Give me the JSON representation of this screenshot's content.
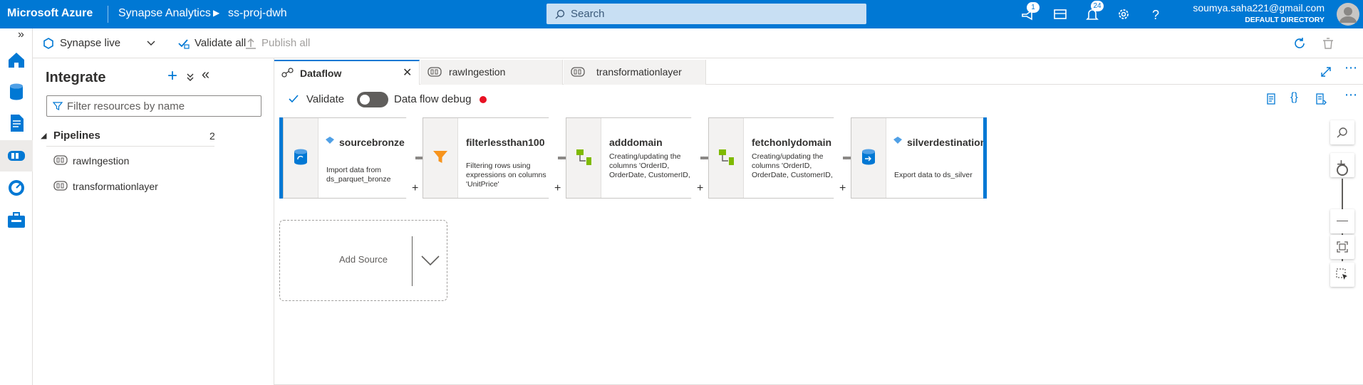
{
  "header": {
    "brand": "Microsoft Azure",
    "product": "Synapse Analytics",
    "workspace": "ss-proj-dwh",
    "search_placeholder": "Search",
    "feedback_badge": "1",
    "notifications_badge": "24",
    "user_email": "soumya.saha221@gmail.com",
    "user_directory": "DEFAULT DIRECTORY",
    "brand_color": "#0078d4"
  },
  "command_bar": {
    "mode_label": "Synapse live",
    "validate_all": "Validate all",
    "publish_all": "Publish all"
  },
  "rail": {
    "items": [
      "home-icon",
      "data-icon",
      "develop-icon",
      "integrate-icon",
      "monitor-icon",
      "manage-icon"
    ],
    "active": "integrate-icon"
  },
  "resource_panel": {
    "title": "Integrate",
    "filter_placeholder": "Filter resources by name",
    "group_label": "Pipelines",
    "group_count": "2",
    "items": [
      "rawIngestion",
      "transformationlayer"
    ]
  },
  "tabs": [
    {
      "label": "Dataflow",
      "active": true
    },
    {
      "label": "rawIngestion",
      "active": false
    },
    {
      "label": "transformationlayer",
      "active": false
    }
  ],
  "toolbar": {
    "validate": "Validate",
    "debug_label": "Data flow debug",
    "debug_on": false
  },
  "flow": {
    "nodes": [
      {
        "name": "sourcebronze",
        "desc": "Import data from ds_parquet_bronze",
        "icon": "source-icon"
      },
      {
        "name": "filterlessthan100",
        "desc": "Filtering rows using expressions on columns 'UnitPrice'",
        "icon": "filter-icon"
      },
      {
        "name": "adddomain",
        "desc": "Creating/updating the columns 'OrderID, OrderDate, CustomerID, CustomerName, CustomerEmail, ProductID, ProductNa...",
        "icon": "derived-column-icon"
      },
      {
        "name": "fetchonlydomain",
        "desc": "Creating/updating the columns 'OrderID, OrderDate, CustomerID, CustomerName, CustomerEmail, ProductID, ProductNa...",
        "icon": "derived-column-icon"
      },
      {
        "name": "silverdestination",
        "desc": "Export data to ds_silver",
        "icon": "sink-icon"
      }
    ],
    "add_source": "Add Source"
  }
}
